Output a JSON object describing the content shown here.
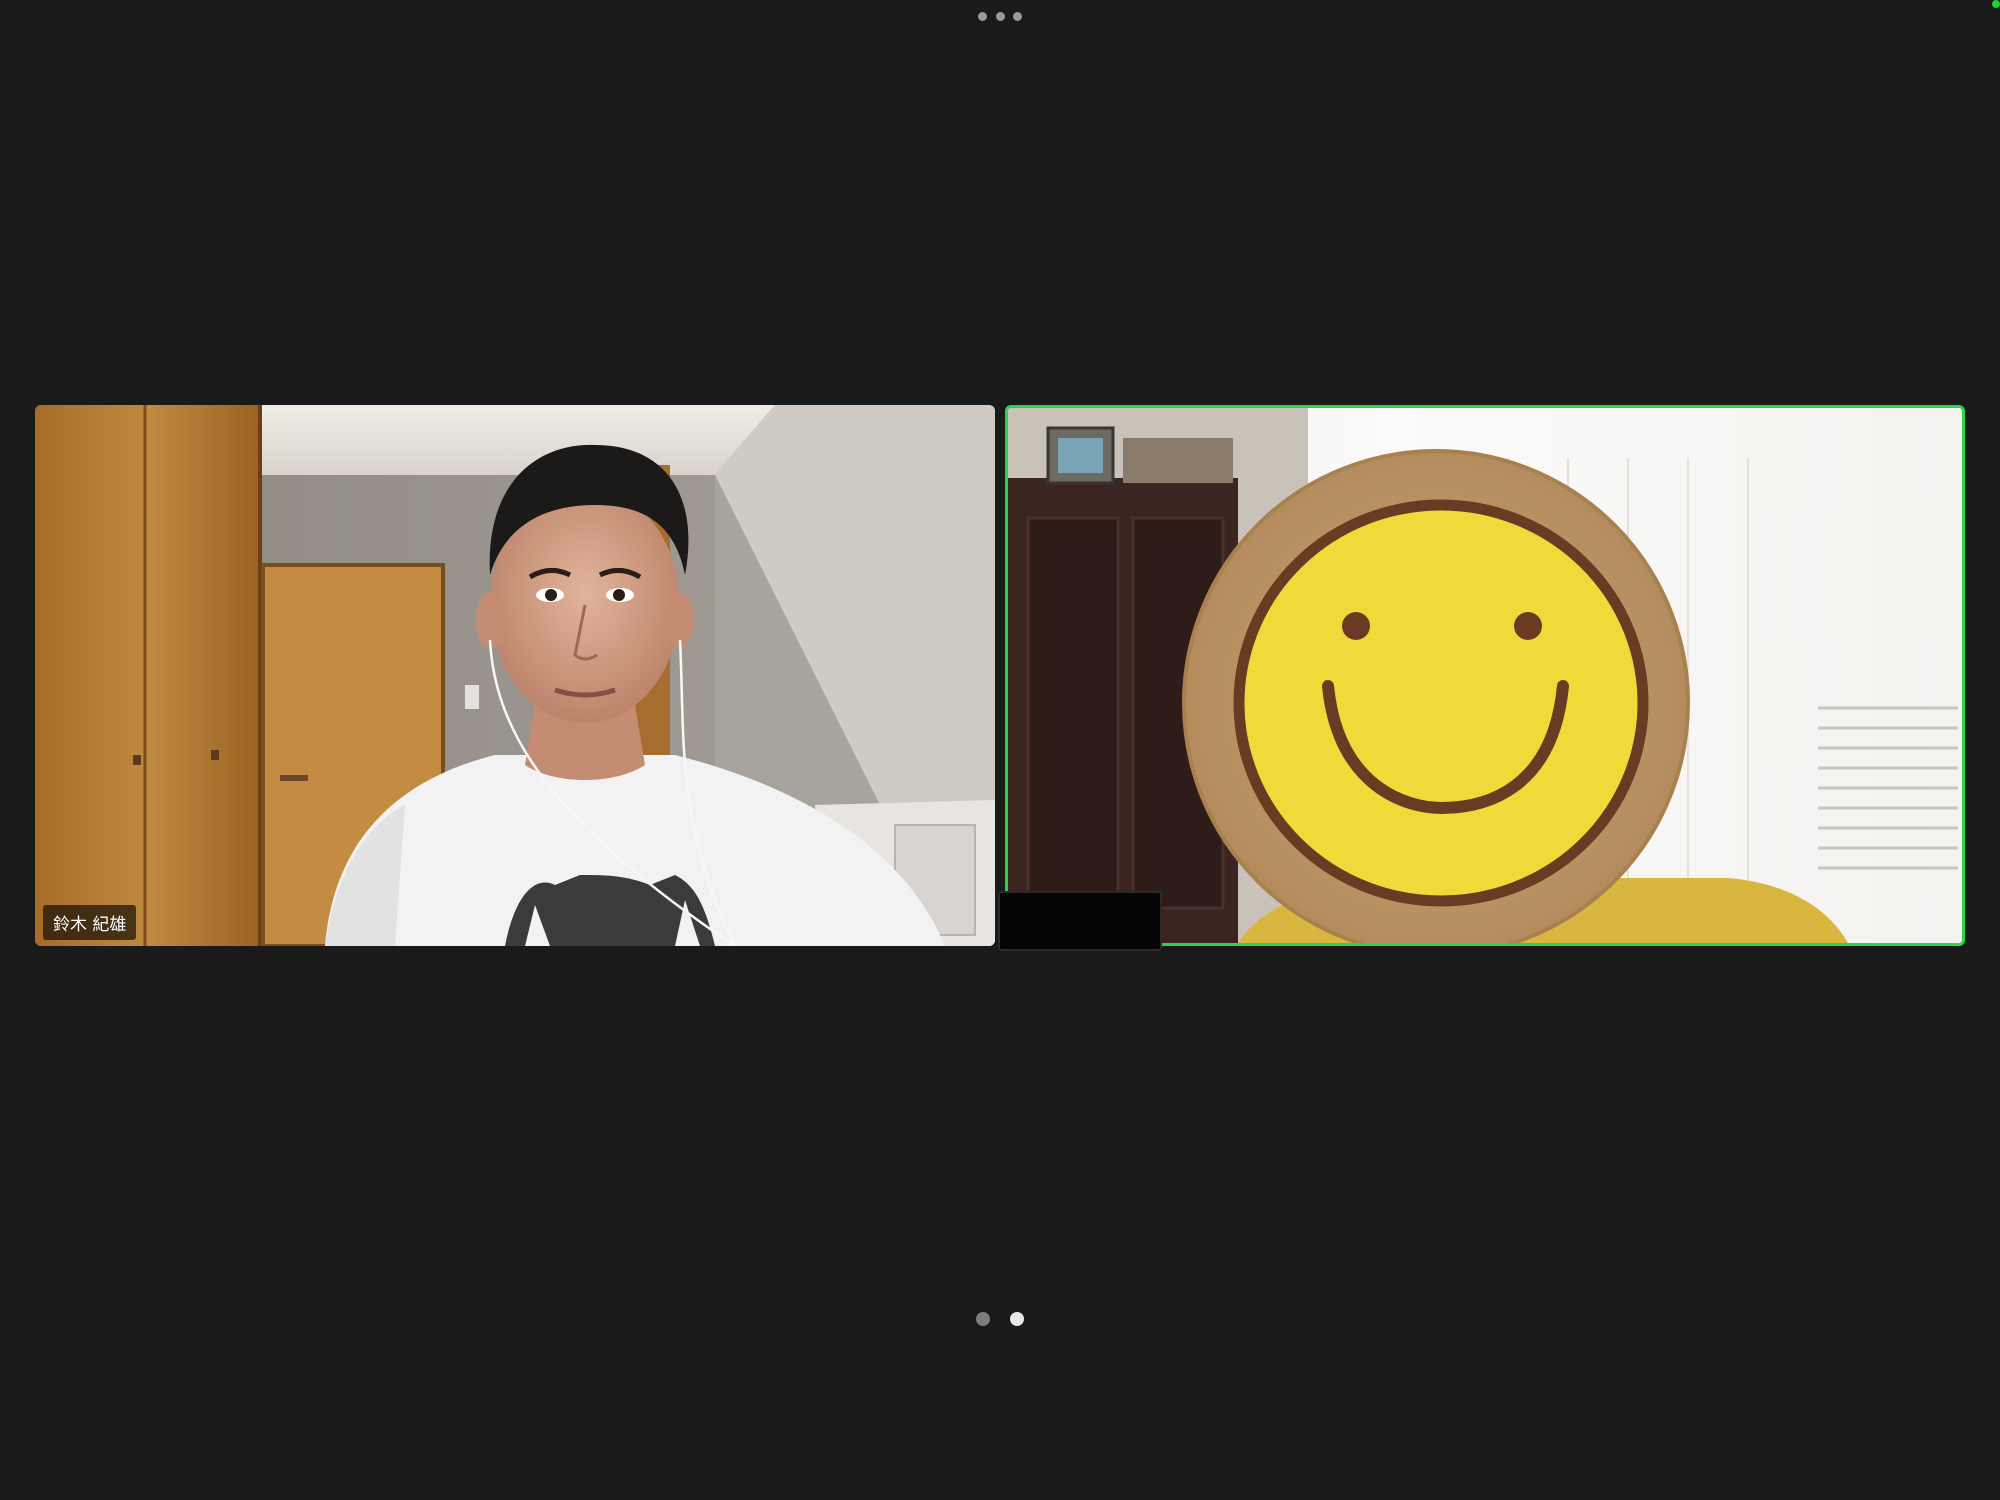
{
  "toolbar": {
    "more_icon": "more-horizontal-icon"
  },
  "participants": [
    {
      "name": "鈴木 紀雄",
      "video": "camera-feed"
    },
    {
      "name": "",
      "video": "smiley-face-avatar",
      "active_speaker": true
    }
  ],
  "pagination": {
    "pages": 2,
    "current": 2
  },
  "colors": {
    "background": "#1a1a1a",
    "active_speaker_border": "#2fd34a",
    "status_dot": "#1fcf3a"
  }
}
